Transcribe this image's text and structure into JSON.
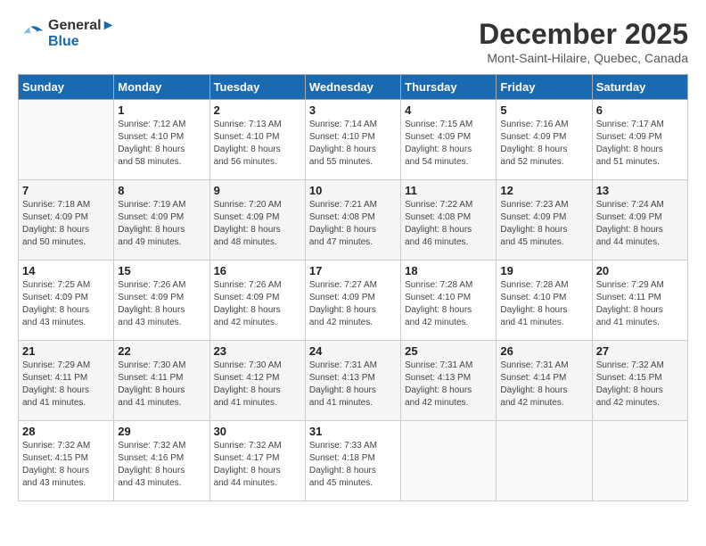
{
  "logo": {
    "line1": "General",
    "line2": "Blue"
  },
  "title": "December 2025",
  "location": "Mont-Saint-Hilaire, Quebec, Canada",
  "days_header": [
    "Sunday",
    "Monday",
    "Tuesday",
    "Wednesday",
    "Thursday",
    "Friday",
    "Saturday"
  ],
  "weeks": [
    [
      {
        "day": "",
        "info": ""
      },
      {
        "day": "1",
        "info": "Sunrise: 7:12 AM\nSunset: 4:10 PM\nDaylight: 8 hours\nand 58 minutes."
      },
      {
        "day": "2",
        "info": "Sunrise: 7:13 AM\nSunset: 4:10 PM\nDaylight: 8 hours\nand 56 minutes."
      },
      {
        "day": "3",
        "info": "Sunrise: 7:14 AM\nSunset: 4:10 PM\nDaylight: 8 hours\nand 55 minutes."
      },
      {
        "day": "4",
        "info": "Sunrise: 7:15 AM\nSunset: 4:09 PM\nDaylight: 8 hours\nand 54 minutes."
      },
      {
        "day": "5",
        "info": "Sunrise: 7:16 AM\nSunset: 4:09 PM\nDaylight: 8 hours\nand 52 minutes."
      },
      {
        "day": "6",
        "info": "Sunrise: 7:17 AM\nSunset: 4:09 PM\nDaylight: 8 hours\nand 51 minutes."
      }
    ],
    [
      {
        "day": "7",
        "info": "Sunrise: 7:18 AM\nSunset: 4:09 PM\nDaylight: 8 hours\nand 50 minutes."
      },
      {
        "day": "8",
        "info": "Sunrise: 7:19 AM\nSunset: 4:09 PM\nDaylight: 8 hours\nand 49 minutes."
      },
      {
        "day": "9",
        "info": "Sunrise: 7:20 AM\nSunset: 4:09 PM\nDaylight: 8 hours\nand 48 minutes."
      },
      {
        "day": "10",
        "info": "Sunrise: 7:21 AM\nSunset: 4:08 PM\nDaylight: 8 hours\nand 47 minutes."
      },
      {
        "day": "11",
        "info": "Sunrise: 7:22 AM\nSunset: 4:08 PM\nDaylight: 8 hours\nand 46 minutes."
      },
      {
        "day": "12",
        "info": "Sunrise: 7:23 AM\nSunset: 4:09 PM\nDaylight: 8 hours\nand 45 minutes."
      },
      {
        "day": "13",
        "info": "Sunrise: 7:24 AM\nSunset: 4:09 PM\nDaylight: 8 hours\nand 44 minutes."
      }
    ],
    [
      {
        "day": "14",
        "info": "Sunrise: 7:25 AM\nSunset: 4:09 PM\nDaylight: 8 hours\nand 43 minutes."
      },
      {
        "day": "15",
        "info": "Sunrise: 7:26 AM\nSunset: 4:09 PM\nDaylight: 8 hours\nand 43 minutes."
      },
      {
        "day": "16",
        "info": "Sunrise: 7:26 AM\nSunset: 4:09 PM\nDaylight: 8 hours\nand 42 minutes."
      },
      {
        "day": "17",
        "info": "Sunrise: 7:27 AM\nSunset: 4:09 PM\nDaylight: 8 hours\nand 42 minutes."
      },
      {
        "day": "18",
        "info": "Sunrise: 7:28 AM\nSunset: 4:10 PM\nDaylight: 8 hours\nand 42 minutes."
      },
      {
        "day": "19",
        "info": "Sunrise: 7:28 AM\nSunset: 4:10 PM\nDaylight: 8 hours\nand 41 minutes."
      },
      {
        "day": "20",
        "info": "Sunrise: 7:29 AM\nSunset: 4:11 PM\nDaylight: 8 hours\nand 41 minutes."
      }
    ],
    [
      {
        "day": "21",
        "info": "Sunrise: 7:29 AM\nSunset: 4:11 PM\nDaylight: 8 hours\nand 41 minutes."
      },
      {
        "day": "22",
        "info": "Sunrise: 7:30 AM\nSunset: 4:11 PM\nDaylight: 8 hours\nand 41 minutes."
      },
      {
        "day": "23",
        "info": "Sunrise: 7:30 AM\nSunset: 4:12 PM\nDaylight: 8 hours\nand 41 minutes."
      },
      {
        "day": "24",
        "info": "Sunrise: 7:31 AM\nSunset: 4:13 PM\nDaylight: 8 hours\nand 41 minutes."
      },
      {
        "day": "25",
        "info": "Sunrise: 7:31 AM\nSunset: 4:13 PM\nDaylight: 8 hours\nand 42 minutes."
      },
      {
        "day": "26",
        "info": "Sunrise: 7:31 AM\nSunset: 4:14 PM\nDaylight: 8 hours\nand 42 minutes."
      },
      {
        "day": "27",
        "info": "Sunrise: 7:32 AM\nSunset: 4:15 PM\nDaylight: 8 hours\nand 42 minutes."
      }
    ],
    [
      {
        "day": "28",
        "info": "Sunrise: 7:32 AM\nSunset: 4:15 PM\nDaylight: 8 hours\nand 43 minutes."
      },
      {
        "day": "29",
        "info": "Sunrise: 7:32 AM\nSunset: 4:16 PM\nDaylight: 8 hours\nand 43 minutes."
      },
      {
        "day": "30",
        "info": "Sunrise: 7:32 AM\nSunset: 4:17 PM\nDaylight: 8 hours\nand 44 minutes."
      },
      {
        "day": "31",
        "info": "Sunrise: 7:33 AM\nSunset: 4:18 PM\nDaylight: 8 hours\nand 45 minutes."
      },
      {
        "day": "",
        "info": ""
      },
      {
        "day": "",
        "info": ""
      },
      {
        "day": "",
        "info": ""
      }
    ]
  ]
}
